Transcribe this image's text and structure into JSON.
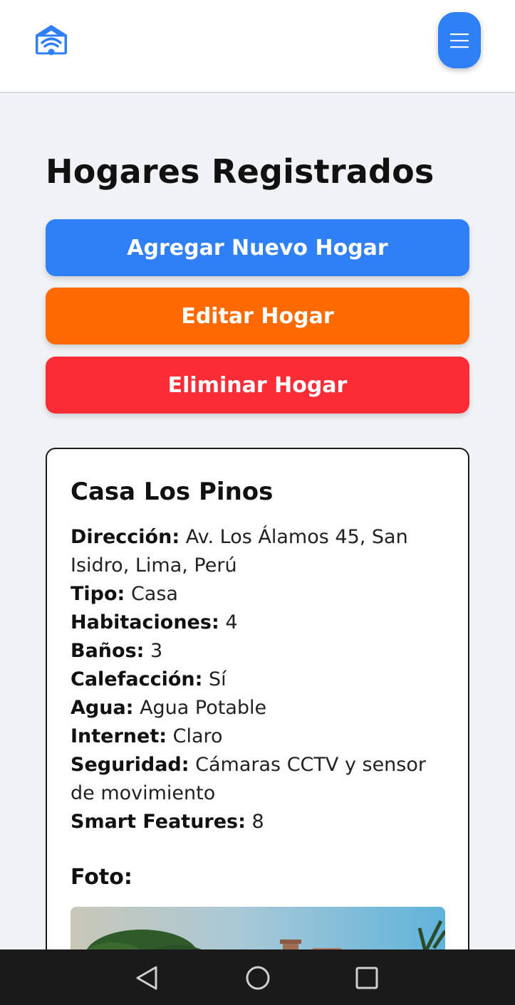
{
  "header": {
    "logo_icon": "smart-home-wifi-icon",
    "menu_icon": "hamburger-menu-icon",
    "accent_color": "#2f7ff6"
  },
  "main": {
    "title": "Hogares Registrados",
    "buttons": {
      "add_label": "Agregar Nuevo Hogar",
      "edit_label": "Editar Hogar",
      "delete_label": "Eliminar Hogar",
      "add_color": "#2f7ff6",
      "edit_color": "#ff6a00",
      "delete_color": "#fc2c37"
    }
  },
  "home": {
    "name": "Casa Los Pinos",
    "details": [
      {
        "label": "Dirección:",
        "value": "Av. Los Álamos 45, San Isidro, Lima, Perú"
      },
      {
        "label": "Tipo:",
        "value": "Casa"
      },
      {
        "label": "Habitaciones:",
        "value": "4"
      },
      {
        "label": "Baños:",
        "value": "3"
      },
      {
        "label": "Calefacción:",
        "value": "Sí"
      },
      {
        "label": "Agua:",
        "value": "Agua Potable"
      },
      {
        "label": "Internet:",
        "value": "Claro"
      },
      {
        "label": "Seguridad:",
        "value": "Cámaras CCTV y sensor de movimiento"
      },
      {
        "label": "Smart Features:",
        "value": "8"
      }
    ],
    "photo_label": "Foto:"
  },
  "system_nav": {
    "back_icon": "back-triangle-icon",
    "home_icon": "home-circle-icon",
    "recents_icon": "recents-square-icon"
  }
}
